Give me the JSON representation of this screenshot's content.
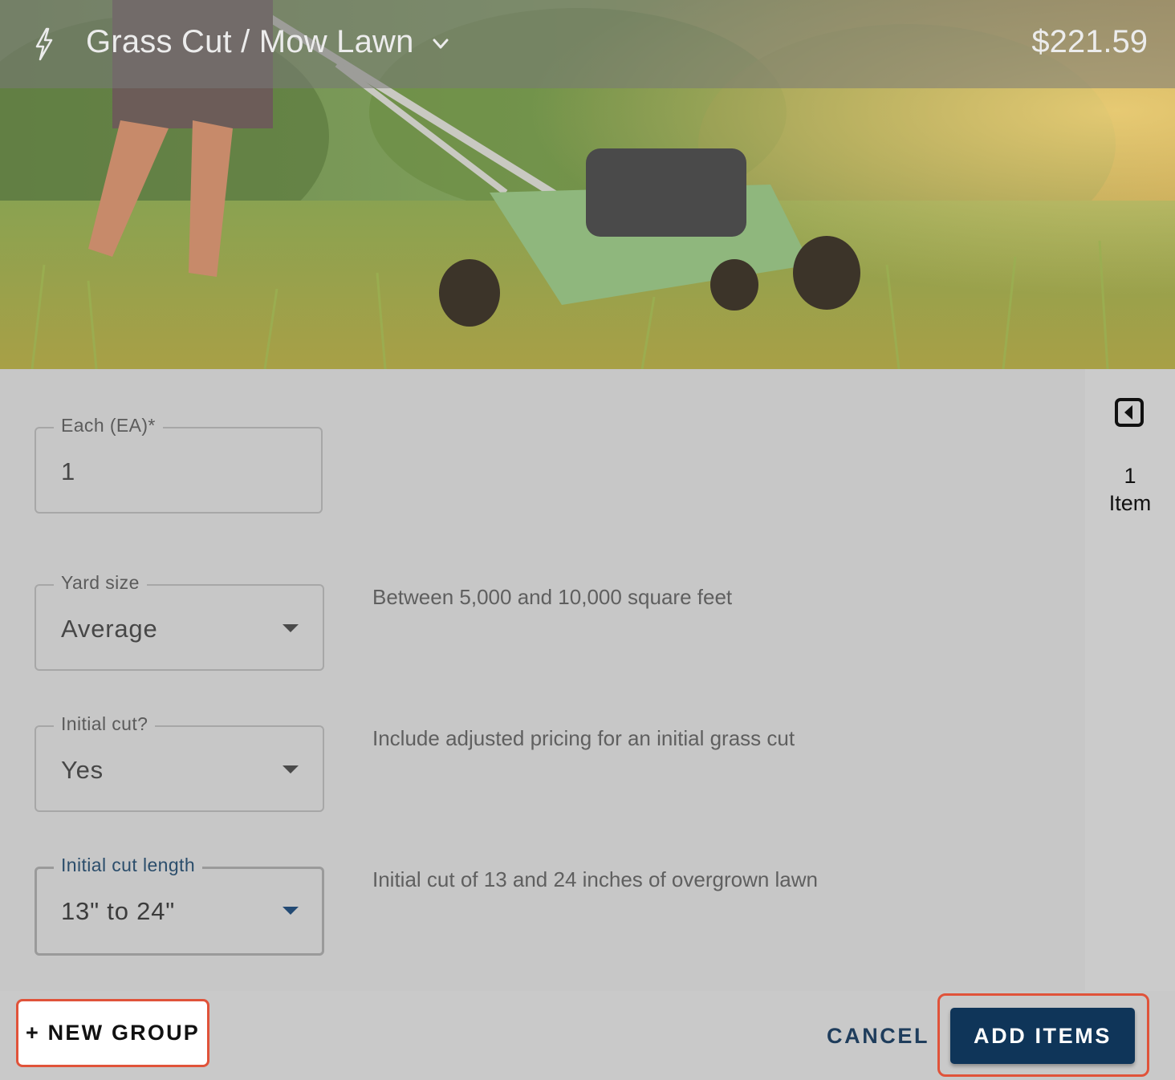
{
  "header": {
    "title": "Grass Cut / Mow Lawn",
    "price": "$221.59",
    "icon": "bolt-icon",
    "dropdown_icon": "chevron-down-icon"
  },
  "hero": {
    "image_subject": "person mowing tall grass with a lawn mower"
  },
  "side_rail": {
    "collapse_icon": "collapse-left-icon",
    "item_count": "1",
    "item_label": "Item"
  },
  "fields": [
    {
      "label": "Each (EA)*",
      "value": "1",
      "type": "text",
      "description": ""
    },
    {
      "label": "Yard size",
      "value": "Average",
      "type": "select",
      "description": "Between 5,000 and 10,000 square feet"
    },
    {
      "label": "Initial cut?",
      "value": "Yes",
      "type": "select",
      "description": "Include adjusted pricing for an initial grass cut"
    },
    {
      "label": "Initial cut length",
      "value": "13\" to 24\"",
      "type": "select",
      "focused": true,
      "description": "Initial cut of 13 and 24 inches of overgrown lawn"
    }
  ],
  "footer": {
    "new_group_label": "+ NEW GROUP",
    "cancel_label": "CANCEL",
    "add_items_label": "ADD ITEMS"
  },
  "colors": {
    "primary": "#0f3559",
    "highlight": "#e0533a",
    "panel": "#c7c7c7"
  }
}
